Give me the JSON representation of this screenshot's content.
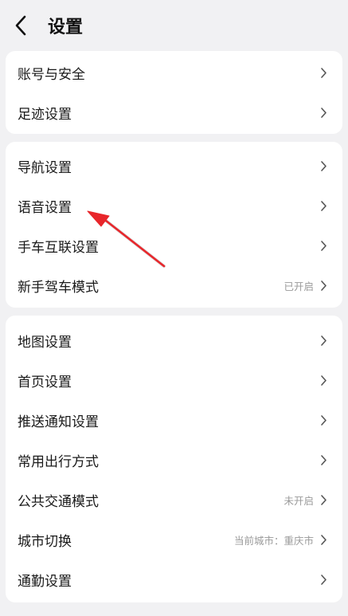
{
  "header": {
    "title": "设置"
  },
  "groups": [
    {
      "items": [
        {
          "label": "账号与安全"
        },
        {
          "label": "足迹设置"
        }
      ]
    },
    {
      "items": [
        {
          "label": "导航设置"
        },
        {
          "label": "语音设置"
        },
        {
          "label": "手车互联设置"
        },
        {
          "label": "新手驾车模式",
          "value": "已开启"
        }
      ]
    },
    {
      "items": [
        {
          "label": "地图设置"
        },
        {
          "label": "首页设置"
        },
        {
          "label": "推送通知设置"
        },
        {
          "label": "常用出行方式"
        },
        {
          "label": "公共交通模式",
          "value": "未开启"
        },
        {
          "label": "城市切换",
          "value": "当前城市：重庆市"
        },
        {
          "label": "通勤设置"
        }
      ]
    }
  ],
  "colors": {
    "background": "#f1f1f3",
    "card": "#ffffff",
    "annotation_arrow": "#e8262b",
    "secondary_text": "#9a9a9a"
  },
  "icons": {
    "back": "chevron-left-icon",
    "row": "chevron-right-icon"
  }
}
